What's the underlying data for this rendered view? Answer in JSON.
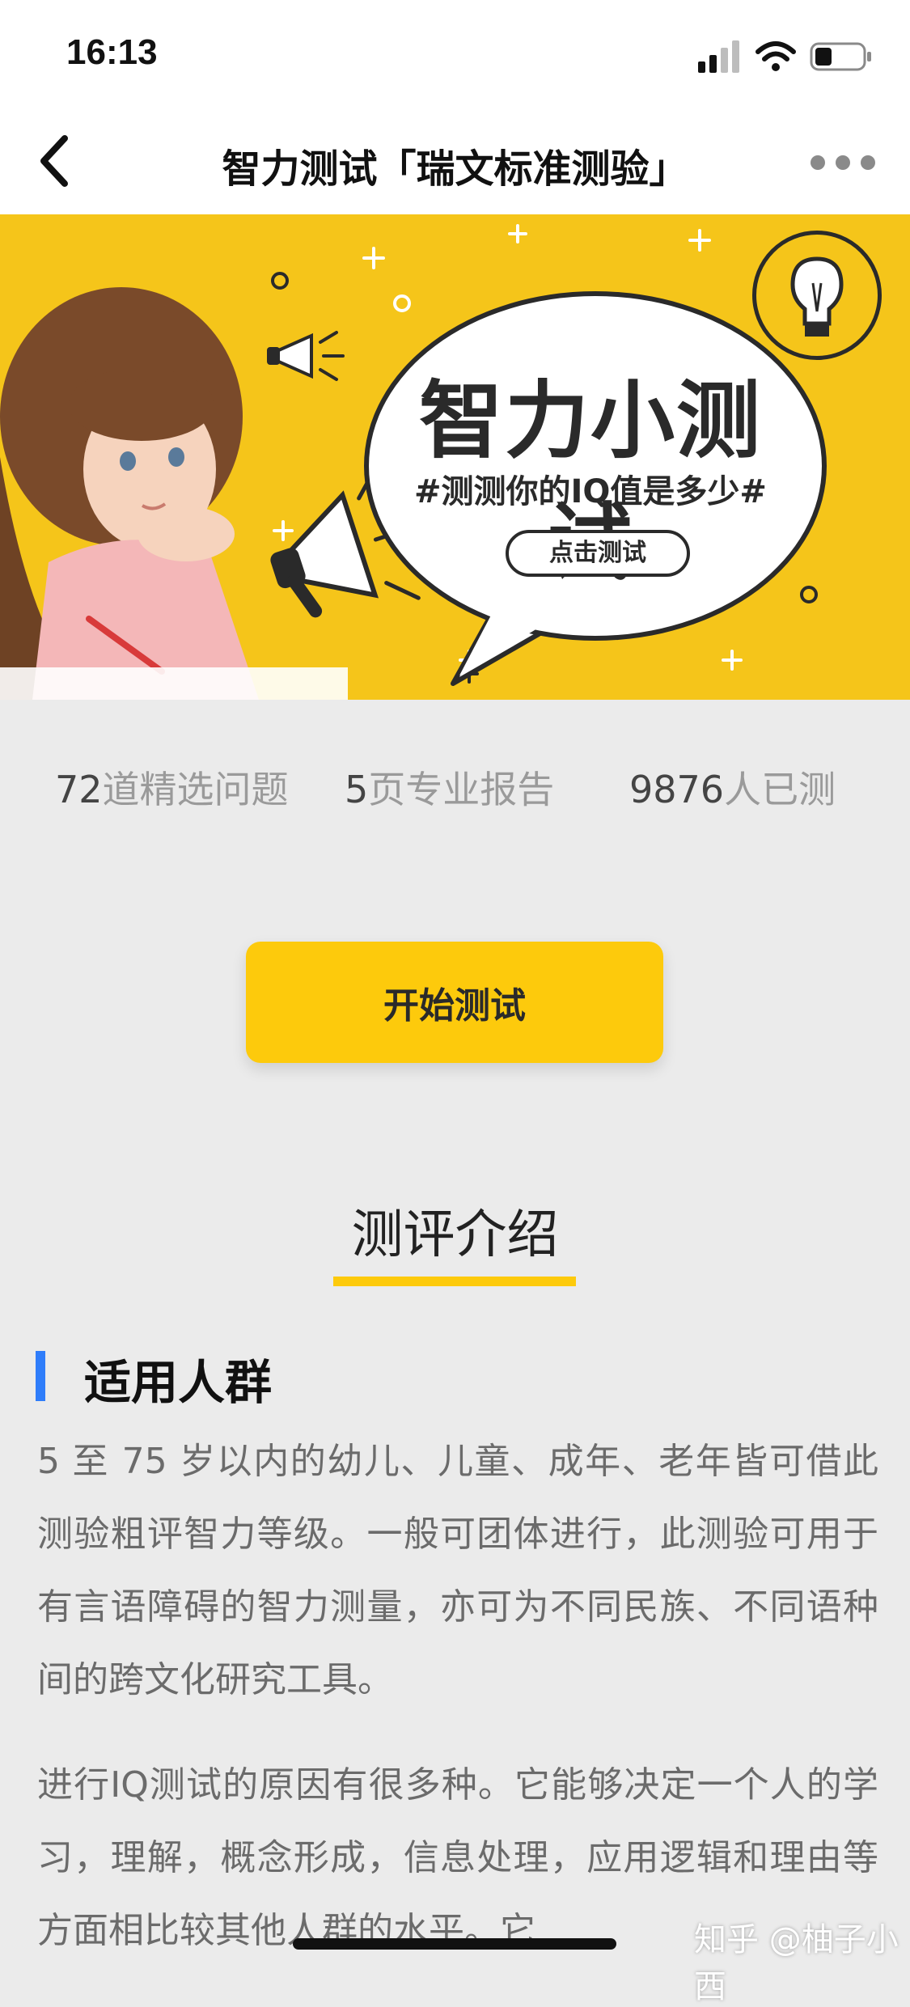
{
  "status_bar": {
    "time": "16:13"
  },
  "nav": {
    "title": "智力测试「瑞文标准测验」"
  },
  "banner": {
    "title": "智力小测试",
    "subtitle": "#测测你的IQ值是多少#",
    "button_label": "点击测试",
    "colors": {
      "background": "#f5c51a",
      "ink": "#2a2a2a"
    }
  },
  "stats": [
    {
      "number": "72",
      "label": "道精选问题"
    },
    {
      "number": "5",
      "label": "页专业报告"
    },
    {
      "number": "9876",
      "label": "人已测"
    }
  ],
  "start_button": {
    "label": "开始测试",
    "color": "#fdca0c"
  },
  "section": {
    "title": "测评介绍",
    "underline_color": "#fdca0c"
  },
  "subsection": {
    "title": "适用人群",
    "accent_color": "#2f7dfa"
  },
  "paragraphs": [
    "5 至 75 岁以内的幼儿、儿童、成年、老年皆可借此测验粗评智力等级。一般可团体进行，此测验可用于有言语障碍的智力测量，亦可为不同民族、不同语种间的跨文化研究工具。",
    "进行IQ测试的原因有很多种。它能够决定一个人的学习，理解，概念形成，信息处理，应用逻辑和理由等方面相比较其他人群的水平。它"
  ],
  "watermark": "知乎 @柚子小西",
  "icons": [
    "back-chevron-icon",
    "more-dots-icon",
    "signal-icon",
    "wifi-icon",
    "battery-icon",
    "megaphone-icon",
    "lightbulb-icon"
  ]
}
